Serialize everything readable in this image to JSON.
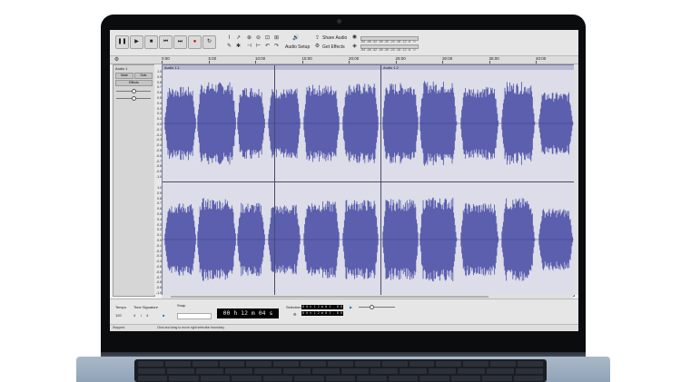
{
  "toolbar": {
    "audio_setup_label": "Audio Setup",
    "share_audio_label": "Share Audio",
    "get_effects_label": "Get Effects",
    "meter_ticks": [
      "-54",
      "-48",
      "-42",
      "-36",
      "-30",
      "-24",
      "-18",
      "-12",
      "-6",
      "0"
    ]
  },
  "ruler": {
    "ticks": [
      "0:00",
      "5:00",
      "10:00",
      "15:00",
      "20:00",
      "25:00",
      "30:00",
      "35:00",
      "40:00"
    ]
  },
  "track": {
    "name": "Audio 1",
    "mute_label": "Mute",
    "solo_label": "Solo",
    "effects_label": "Effects",
    "clip1_name": "Audio 1.1",
    "clip2_name": "Audio 1.2",
    "scale_labels": [
      "1.0",
      "0.9",
      "0.8",
      "0.7",
      "0.6",
      "0.5",
      "0.4",
      "0.3",
      "0.2",
      "0.1",
      "0.0",
      "-0.1",
      "-0.2",
      "-0.3",
      "-0.4",
      "-0.5",
      "-0.6",
      "-0.7",
      "-0.8",
      "-0.9",
      "-1.0"
    ]
  },
  "bottom": {
    "tempo_label": "Tempo",
    "tempo_value": "120",
    "time_signature_label": "Time Signature",
    "time_signature_num": "4",
    "time_signature_den": "4",
    "snap_label": "Snap",
    "time_display": "00 h 12 m 04 s",
    "selection_label": "Selection",
    "selection_start": "0 0 h 1 2 m 0 3 . 8 8 1 s",
    "selection_end": "0 0 h 1 2 m 0 3 . 8 8 1 s"
  },
  "status": {
    "state": "Stopped.",
    "hint": "Click and drag to move right selection boundary."
  },
  "colors": {
    "waveform": "#5b5fad",
    "clip_bg": "#dcdde8",
    "bezel": "#0b0c0e"
  }
}
